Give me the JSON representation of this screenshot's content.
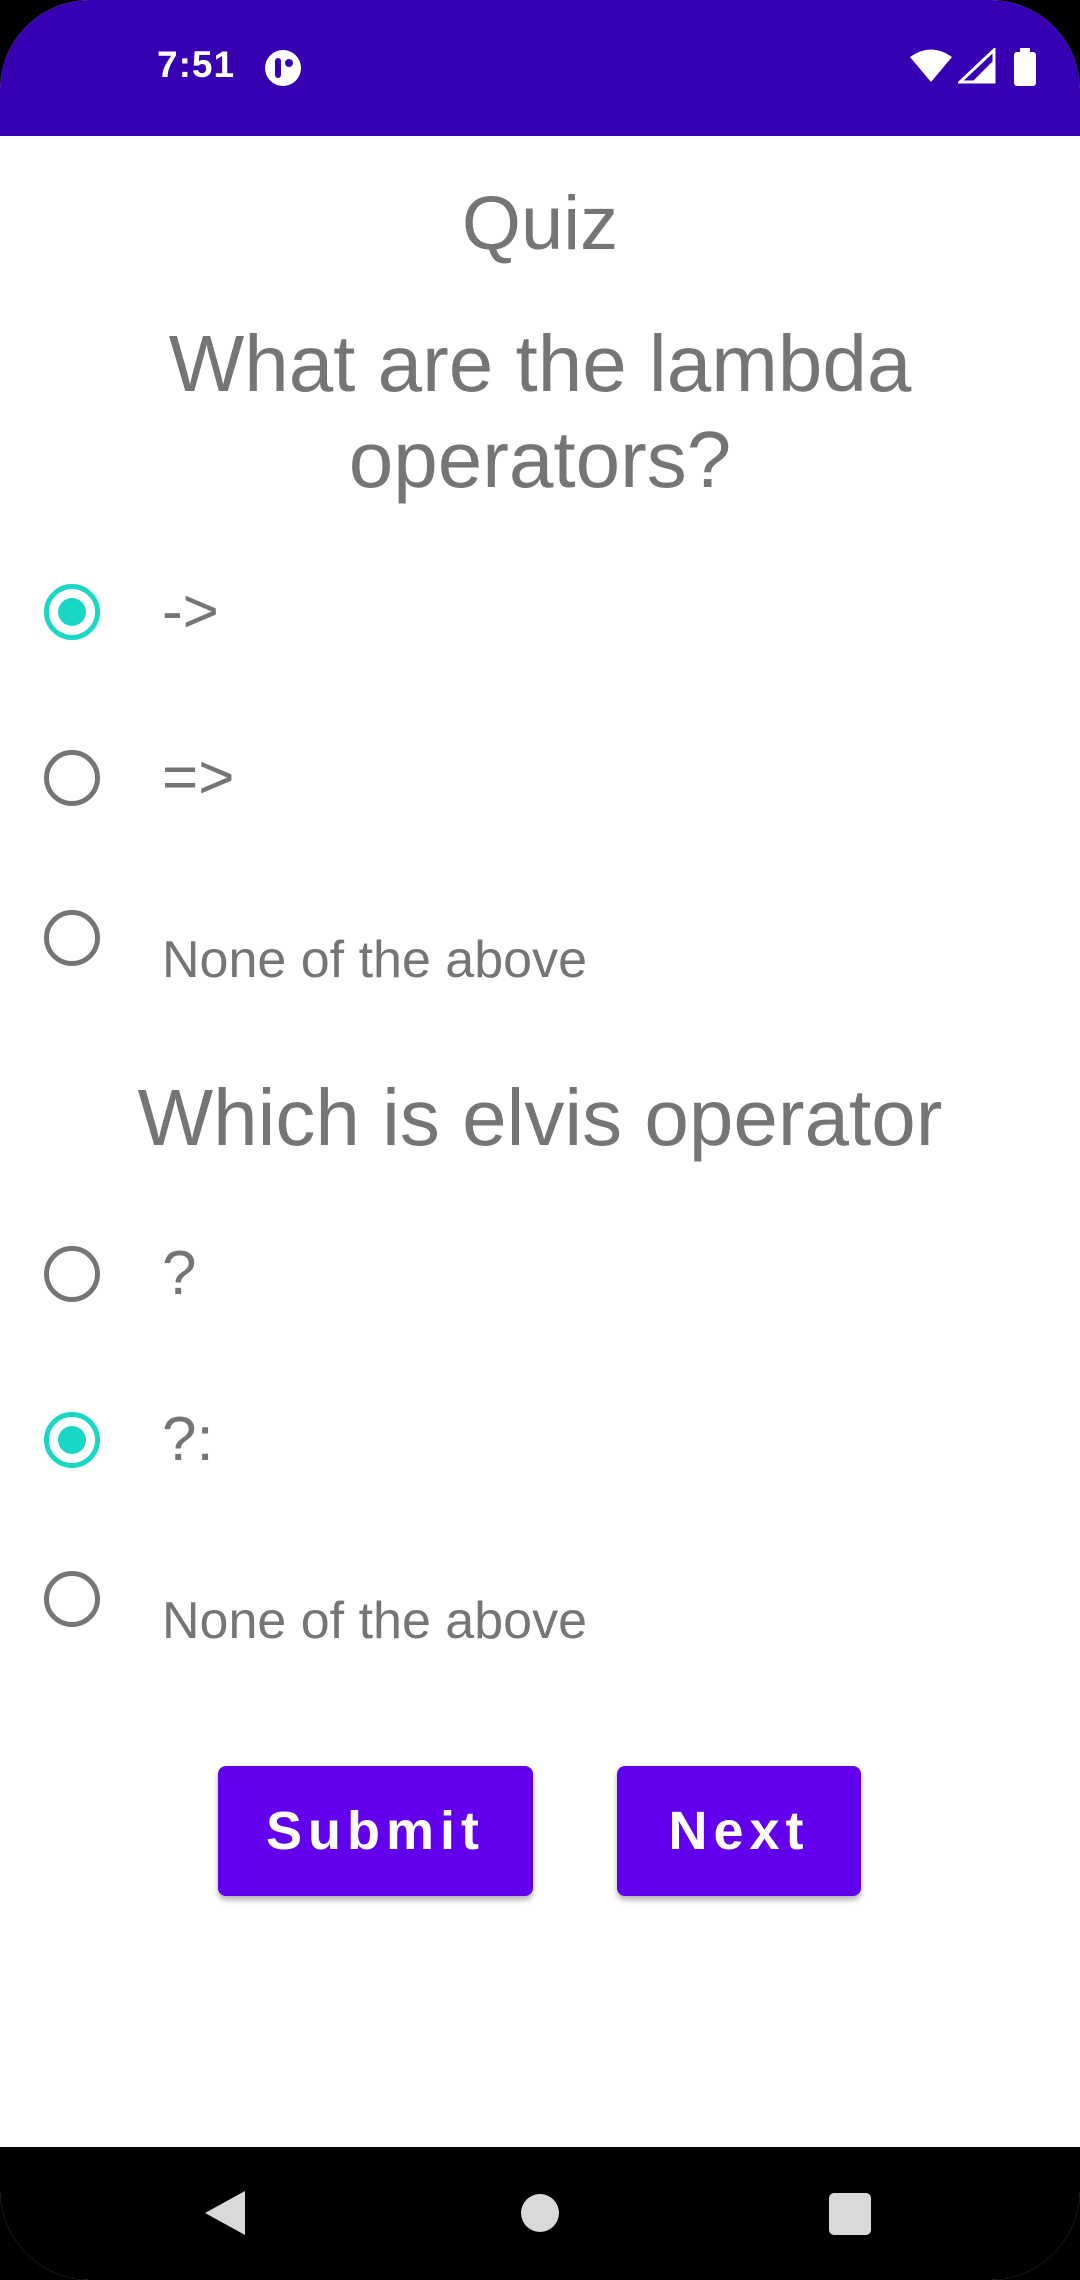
{
  "status_bar": {
    "time": "7:51",
    "background": "#3700b3",
    "icons": [
      "app-notification-icon",
      "wifi-icon",
      "signal-icon",
      "battery-icon"
    ]
  },
  "page": {
    "title": "Quiz"
  },
  "questions": [
    {
      "text": "What are the lambda operators?",
      "options": [
        {
          "label": "->",
          "checked": true
        },
        {
          "label": "=>",
          "checked": false
        },
        {
          "label": "None of the above",
          "checked": false
        }
      ]
    },
    {
      "text": "Which is elvis operator",
      "options": [
        {
          "label": "?",
          "checked": false
        },
        {
          "label": "?:",
          "checked": true
        },
        {
          "label": "None of the above",
          "checked": false
        }
      ]
    }
  ],
  "buttons": {
    "submit_label": "Submit",
    "next_label": "Next",
    "color": "#6200ee"
  },
  "colors": {
    "radio_checked": "#18d7c4",
    "text": "#757575"
  },
  "nav_bar": {
    "icons": [
      "back-icon",
      "home-icon",
      "recents-icon"
    ]
  }
}
